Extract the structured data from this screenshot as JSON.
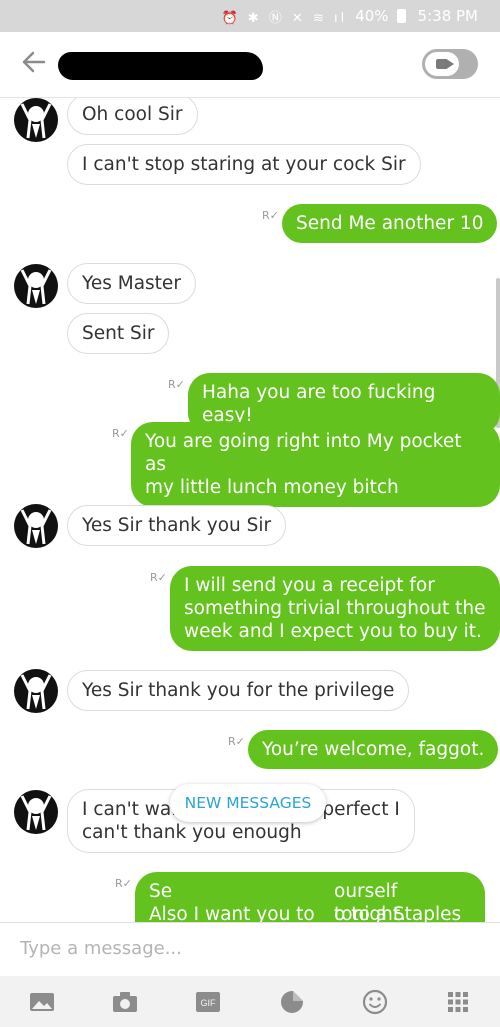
{
  "status_bar": {
    "battery": "40%",
    "time": "5:38 PM",
    "icons": [
      "alarm-icon",
      "bluetooth-icon",
      "nfc-icon",
      "mute-icon",
      "wifi-icon",
      "signal-icon",
      "battery-icon"
    ]
  },
  "header": {
    "back_icon": "arrow-left-icon",
    "video_icon": "video-camera-icon"
  },
  "read_mark": "R",
  "messages": [
    {
      "side": "in",
      "text": "Oh cool Sir"
    },
    {
      "side": "in",
      "text": "I can't stop staring at your cock Sir"
    },
    {
      "side": "out",
      "text": "Send Me another 10"
    },
    {
      "side": "in",
      "text": "Yes Master"
    },
    {
      "side": "in",
      "text": "Sent Sir"
    },
    {
      "side": "out",
      "text": "Haha you are too fucking easy!"
    },
    {
      "side": "out",
      "line1": "You are going right into My pocket as",
      "line2": "my little lunch money bitch"
    },
    {
      "side": "in",
      "text": "Yes Sir thank you Sir"
    },
    {
      "side": "out",
      "line1": "I will send you a receipt for",
      "line2": "something trivial throughout the",
      "line3": "week and I expect you to buy it."
    },
    {
      "side": "in",
      "text": "Yes Sir thank you for the privilege"
    },
    {
      "side": "out",
      "text": "You’re welcome, faggot."
    },
    {
      "side": "in",
      "line1": "I can't wait Sir you are so perfect I",
      "line2": "can't thank you enough"
    },
    {
      "side": "out",
      "line1_left": "Se",
      "line1_right": "ourself tonight.",
      "line2_left": "Also I want you to",
      "line2_right": "o to a Staples or"
    }
  ],
  "new_messages_label": "NEW MESSAGES",
  "composer": {
    "placeholder": "Type a message..."
  },
  "toolbar": {
    "gif_label": "GIF",
    "icons": [
      "gallery-icon",
      "camera-icon",
      "gif-icon",
      "sticker-icon",
      "emoji-icon",
      "apps-grid-icon"
    ]
  },
  "colors": {
    "outgoing": "#64c21e",
    "incoming_border": "#dcdcdc",
    "new_messages": "#2aa3d6",
    "status_bar": "#d7d7d7"
  }
}
